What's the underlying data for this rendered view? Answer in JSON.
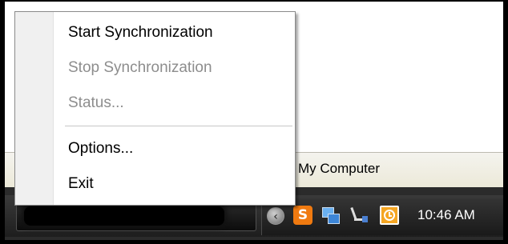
{
  "context_menu": {
    "items": [
      {
        "label": "Start Synchronization",
        "enabled": true
      },
      {
        "label": "Stop Synchronization",
        "enabled": false
      },
      {
        "label": "Status...",
        "enabled": false
      },
      {
        "label": "Options...",
        "enabled": true
      },
      {
        "label": "Exit",
        "enabled": true
      }
    ]
  },
  "start_menu": {
    "my_computer_label": "My Computer"
  },
  "taskbar": {
    "tray": {
      "expand_arrow_glyph": "‹",
      "sync_icon_glyph": "S",
      "icons": [
        "sync-app-icon",
        "network-icon",
        "cable-icon",
        "clock-app-icon"
      ],
      "clock": "10:46 AM"
    }
  },
  "colors": {
    "disabled_text": "#8d8d8d",
    "sync_icon": "#f07a10",
    "clock_icon": "#f5a623",
    "taskbar": "#2b2b2b"
  }
}
